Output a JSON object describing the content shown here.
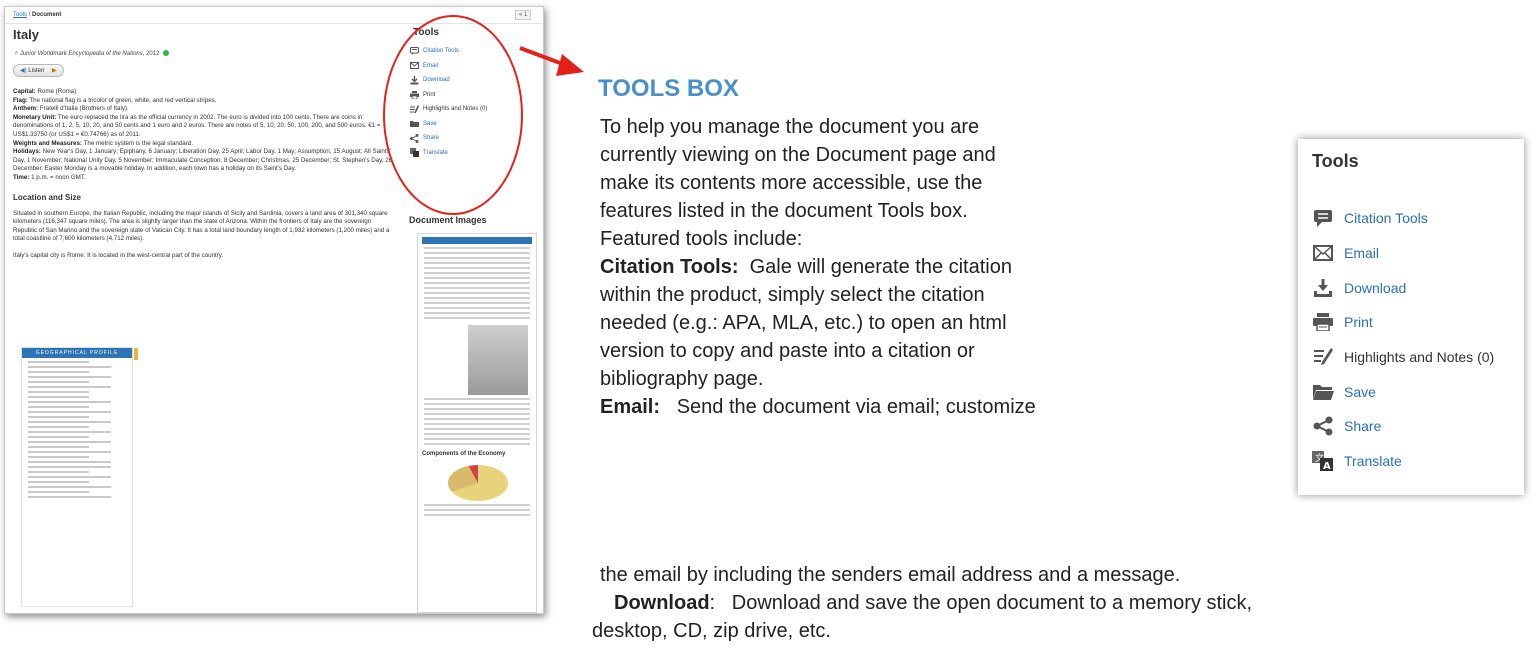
{
  "screenshot": {
    "breadcrumb_link": "Tools",
    "breadcrumb_sep": "\\",
    "breadcrumb_current": "Document",
    "pager": "« 1",
    "title": "Italy",
    "source_title": "Junior Worldmark Encyclopedia of the Nations",
    "source_year": ", 2012",
    "listen_label": "Listen",
    "facts": [
      {
        "label": "Capital:",
        "text": "Rome (Roma)"
      },
      {
        "label": "Flag:",
        "text": "The national flag is a tricolor of green, white, and red vertical stripes."
      },
      {
        "label": "Anthem:",
        "text": "Fratelli d'Italia (Brothers of Italy)."
      },
      {
        "label": "Monetary Unit:",
        "text": "The euro replaced the lira as the official currency in 2002. The euro is divided into 100 cents. There are coins in denominations of 1, 2, 5, 10, 20, and 50 cents and 1 euro and 2 euros. There are notes of 5, 10, 20, 50, 100, 200, and 500 euros. €1 = US$1.33750 (or US$1 = €0.74766) as of 2011."
      },
      {
        "label": "Weights and Measures:",
        "text": "The metric system is the legal standard."
      },
      {
        "label": "Holidays:",
        "text": "New Year's Day, 1 January; Epiphany, 6 January; Liberation Day, 25 April; Labor Day, 1 May; Assumption, 15 August; All Saints' Day, 1 November; National Unity Day, 5 November; Immaculate Conception, 8 December; Christmas, 25 December; St. Stephen's Day, 26 December. Easter Monday is a movable holiday. In addition, each town has a holiday on its Saint's Day."
      },
      {
        "label": "Time:",
        "text": "1 p.m. = noon GMT."
      }
    ],
    "section_heading": "Location and Size",
    "location_para": "Situated in southern Europe, the Italian Republic, including the major islands of Sicily and Sardinia, covers a land area of 301,340 square kilometers (116,347 square miles). The area is slightly larger than the state of Arizona. Within the frontiers of Italy are the sovereign Republic of San Marino and the sovereign state of Vatican City. It has a total land boundary length of 1,932 kilometers (1,200 miles) and a total coastline of 7,600 kilometers (4,712 miles).",
    "capital_para": "Italy's capital city is Rome. It is located in the west-central part of the country.",
    "profile_header": "GEOGRAPHICAL PROFILE",
    "tools_title": "Tools",
    "tools": [
      {
        "icon": "citation-icon",
        "label": "Citation Tools"
      },
      {
        "icon": "email-icon",
        "label": "Email"
      },
      {
        "icon": "download-icon",
        "label": "Download"
      },
      {
        "icon": "print-icon",
        "label": "Print"
      },
      {
        "icon": "highlights-icon",
        "label": "Highlights and Notes (0)"
      },
      {
        "icon": "folder-icon",
        "label": "Save"
      },
      {
        "icon": "share-icon",
        "label": "Share"
      },
      {
        "icon": "translate-icon",
        "label": "Translate"
      }
    ],
    "document_images_title": "Document Images",
    "thumb_caption": "Components of the Economy"
  },
  "article": {
    "heading": "TOOLS BOX",
    "intro_lines": [
      "To help you manage the document you are",
      "currently viewing on the Document page and",
      "make its contents more accessible, use the",
      "features listed in the document Tools box.",
      "Featured tools include:"
    ],
    "citation_label": "Citation Tools:",
    "citation_lines": [
      "  Gale will generate the citation",
      "within the product, simply select the citation",
      "needed (e.g.: APA, MLA, etc.) to open an html",
      "version to copy and paste into a citation or",
      "bibliography page."
    ],
    "email_label": "Email:",
    "email_lines": [
      "   Send the document via email; customize",
      "the email by including the senders email address and a message."
    ],
    "download_label": "Download",
    "download_lines": [
      ":   Download and save the open document to a memory stick,",
      "desktop, CD, zip drive, etc."
    ]
  },
  "tools_box": {
    "title": "Tools",
    "items": [
      {
        "icon": "citation-icon",
        "label": "Citation Tools"
      },
      {
        "icon": "email-icon",
        "label": "Email"
      },
      {
        "icon": "download-icon",
        "label": "Download"
      },
      {
        "icon": "print-icon",
        "label": "Print"
      },
      {
        "icon": "highlights-icon",
        "label": "Highlights and Notes (0)"
      },
      {
        "icon": "folder-icon",
        "label": "Save"
      },
      {
        "icon": "share-icon",
        "label": "Share"
      },
      {
        "icon": "translate-icon",
        "label": "Translate"
      }
    ]
  },
  "colors": {
    "accent_link": "#2a6ebb",
    "heading_blue": "#4a90c8",
    "highlight_red": "#e32119"
  }
}
